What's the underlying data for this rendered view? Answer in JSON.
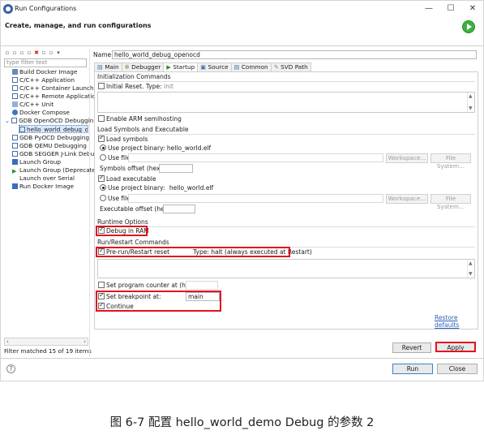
{
  "window": {
    "title": "Run Configurations",
    "header_title": "Create, manage, and run configurations",
    "minimize": "—",
    "maximize": "☐",
    "close": "✕"
  },
  "sidebar": {
    "filter_placeholder": "type filter text",
    "items": [
      {
        "label": "Build Docker Image",
        "indent": 1
      },
      {
        "label": "C/C++ Application",
        "indent": 1
      },
      {
        "label": "C/C++ Container Launche",
        "indent": 1
      },
      {
        "label": "C/C++ Remote Applicatio",
        "indent": 1
      },
      {
        "label": "C/C++ Unit",
        "indent": 1
      },
      {
        "label": "Docker Compose",
        "indent": 1
      },
      {
        "label": "GDB OpenOCD Debuggin",
        "indent": 0,
        "expander": "⌄"
      },
      {
        "label": "hello_world_debug_ope",
        "indent": 2,
        "selected": true
      },
      {
        "label": "GDB PyOCD Debugging",
        "indent": 1
      },
      {
        "label": "GDB QEMU Debugging",
        "indent": 1
      },
      {
        "label": "GDB SEGGER J-Link Debu",
        "indent": 1
      },
      {
        "label": "Launch Group",
        "indent": 1
      },
      {
        "label": "Launch Group (Deprecate",
        "indent": 1
      },
      {
        "label": "Launch over Serial",
        "indent": 1
      },
      {
        "label": "Run Docker Image",
        "indent": 1
      }
    ],
    "filter_status": "Filter matched 15 of 19 items"
  },
  "config": {
    "name_label": "Name:",
    "name_value": "hello_world_debug_openocd",
    "tabs": [
      "Main",
      "Debugger",
      "Startup",
      "Source",
      "Common",
      "SVD Path"
    ],
    "active_tab": "Startup"
  },
  "startup": {
    "init_title": "Initialization Commands",
    "initial_reset": "Initial Reset.",
    "type_label": "Type:",
    "type_value": "init",
    "enable_semihosting": "Enable ARM semihosting",
    "load_title": "Load Symbols and Executable",
    "load_symbols": "Load symbols",
    "use_project_binary": "Use project binary:",
    "symbols_binary": "hello_world.elf",
    "use_file": "Use file:",
    "workspace_btn": "Workspace...",
    "filesystem_btn": "File System...",
    "symbols_offset": "Symbols offset (hex):",
    "load_executable": "Load executable",
    "exec_binary": "hello_world.elf",
    "exec_offset": "Executable offset (hex):",
    "runtime_title": "Runtime Options",
    "debug_in_ram": "Debug in RAM",
    "restart_title": "Run/Restart Commands",
    "prerun_reset": "Pre-run/Restart reset",
    "prerun_type_value": "halt",
    "prerun_note": "(always executed at Restart)",
    "set_pc": "Set program counter at (hex):",
    "set_breakpoint": "Set breakpoint at:",
    "breakpoint_value": "main",
    "continue": "Continue",
    "restore_defaults": "Restore defaults"
  },
  "buttons": {
    "revert": "Revert",
    "apply": "Apply",
    "run": "Run",
    "close": "Close",
    "help": "?"
  },
  "caption": "图 6-7 配置 hello_world_demo Debug 的参数 2",
  "colors": {
    "highlight": "#e2101e",
    "link": "#2a62b8",
    "run_green": "#3db13d"
  }
}
